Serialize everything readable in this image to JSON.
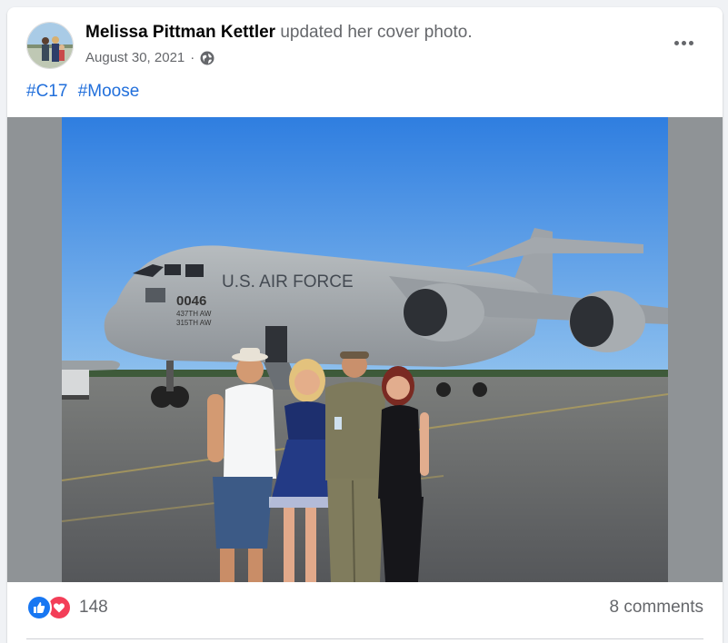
{
  "post": {
    "author": "Melissa Pittman Kettler",
    "action": " updated her cover photo.",
    "date": "August 30, 2021",
    "separator": "·",
    "privacy_icon": "globe-icon",
    "hashtags": [
      "#C17",
      "#Moose"
    ],
    "photo": {
      "aircraft_text": "U.S. AIR FORCE",
      "tail_number": "0046",
      "wing_line_1": "437TH AW",
      "wing_line_2": "315TH AW"
    }
  },
  "footer": {
    "reaction_icons": [
      "like-icon",
      "love-icon"
    ],
    "reaction_count": "148",
    "comments": "8 comments"
  },
  "colors": {
    "link": "#216fdb",
    "like": "#1877f2",
    "love": "#f33e58",
    "secondary_text": "#65676b"
  }
}
